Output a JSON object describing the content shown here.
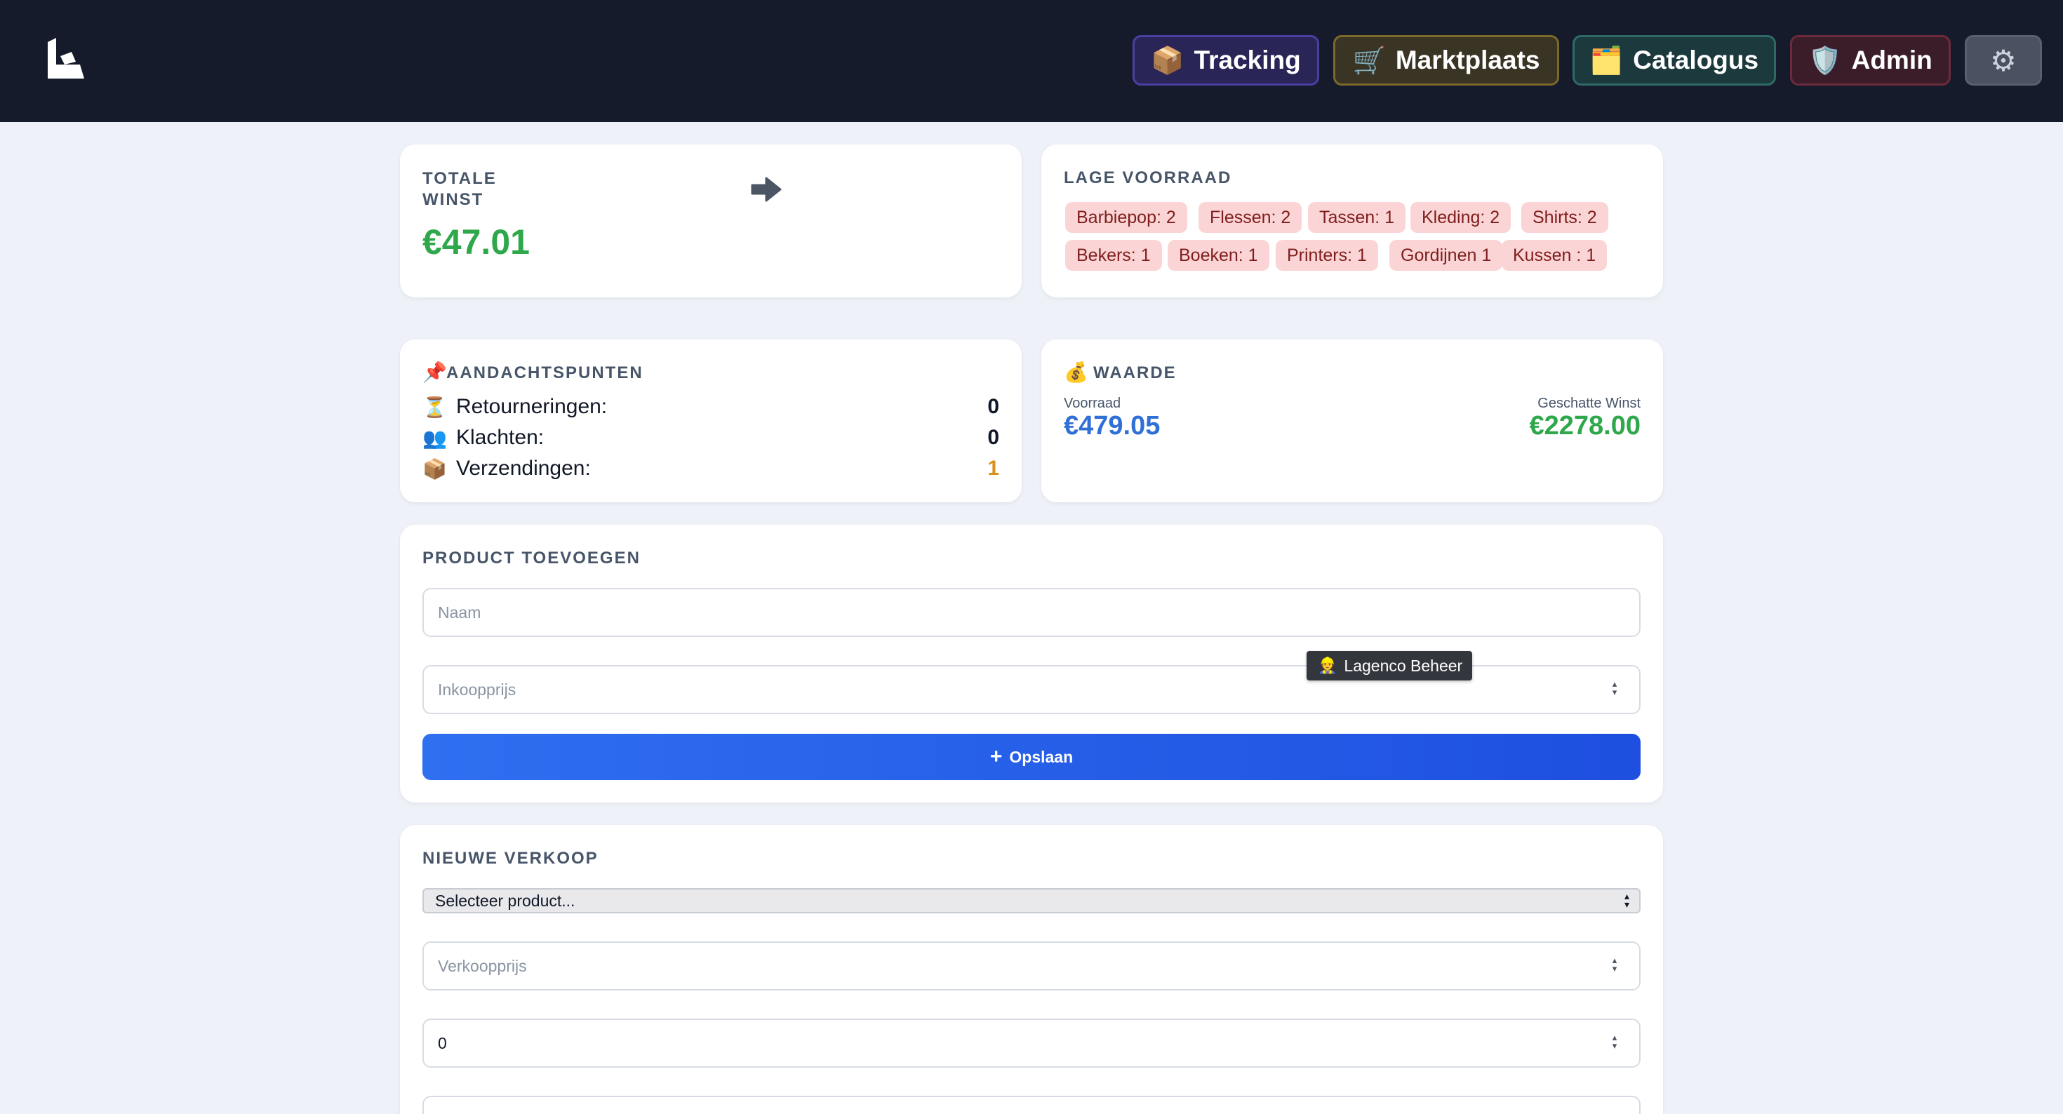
{
  "nav": {
    "tracking": {
      "icon": "📦",
      "label": "Tracking"
    },
    "marktplaats": {
      "icon": "🛒",
      "label": "Marktplaats"
    },
    "catalogus": {
      "icon": "🗂️",
      "label": "Catalogus"
    },
    "admin": {
      "icon": "🛡️",
      "label": "Admin"
    },
    "settings": {
      "icon": "⚙"
    }
  },
  "profit": {
    "title_line1": "TOTALE",
    "title_line2": "WINST",
    "value": "€47.01"
  },
  "low_stock": {
    "title": "LAGE VOORRAAD",
    "items": [
      "Barbiepop: 2",
      "Flessen: 2",
      "Tassen: 1",
      "Kleding: 2",
      "Shirts: 2",
      "Bekers: 1",
      "Boeken: 1",
      "Printers: 1",
      "Gordijnen 1",
      "Kussen : 1"
    ]
  },
  "attention": {
    "icon": "📌",
    "title": "AANDACHTSPUNTEN",
    "rows": [
      {
        "icon": "⏳",
        "label": "Retourneringen:",
        "value": "0"
      },
      {
        "icon": "👥",
        "label": "Klachten:",
        "value": "0"
      },
      {
        "icon": "📦",
        "label": "Verzendingen:",
        "value": "1"
      }
    ]
  },
  "value": {
    "icon": "💰",
    "title": "WAARDE",
    "stock_label": "Voorraad",
    "stock_value": "€479.05",
    "profit_label": "Geschatte Winst",
    "profit_value": "€2278.00"
  },
  "add_product": {
    "title": "PRODUCT TOEVOEGEN",
    "name_placeholder": "Naam",
    "price_placeholder": "Inkoopprijs",
    "save_label": "Opslaan"
  },
  "tooltip": {
    "icon": "👷",
    "text": "Lagenco Beheer"
  },
  "new_sale": {
    "title": "NIEUWE VERKOOP",
    "select_value": "Selecteer product...",
    "price_placeholder": "Verkoopprijs",
    "quantity_value": "0"
  },
  "colors": {
    "topbar": "#151b2b",
    "page_bg": "#eef2f8",
    "profit_green": "#2ea84b",
    "stock_blue": "#2f6fd6",
    "warning_orange": "#d9901c",
    "button_blue": "#2563eb"
  }
}
